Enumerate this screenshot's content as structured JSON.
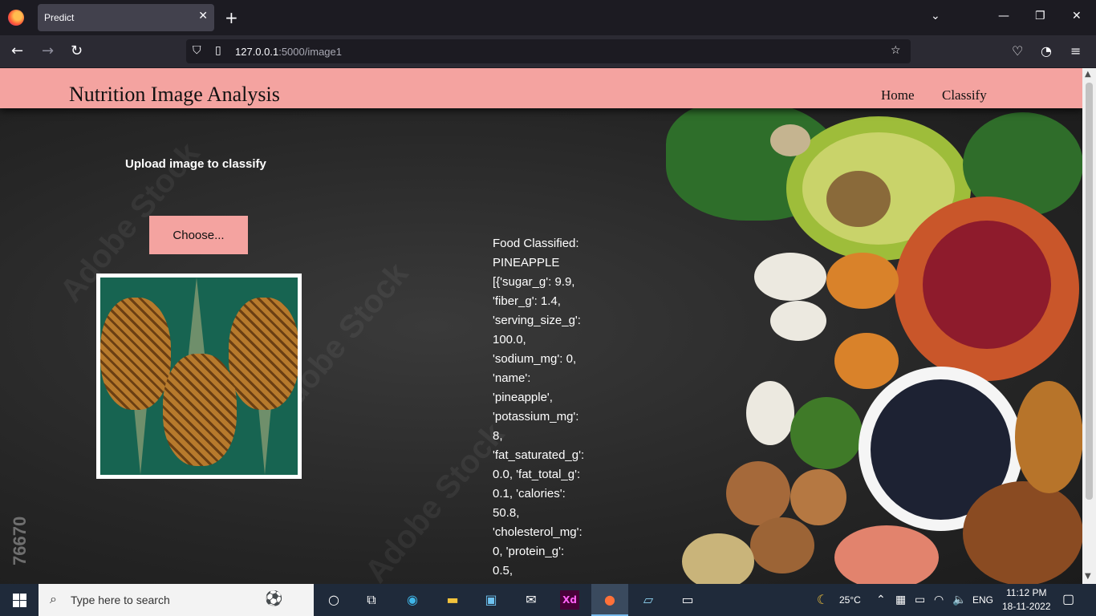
{
  "browser": {
    "tab_title": "Predict",
    "url_host": "127.0.0.1",
    "url_path": ":5000/image1"
  },
  "site": {
    "title": "Nutrition Image Analysis",
    "nav": [
      "Home",
      "Classify"
    ]
  },
  "upload": {
    "label": "Upload image to classify",
    "button": "Choose..."
  },
  "result": {
    "lines": [
      "Food Classified:",
      "PINEAPPLE",
      "[{'sugar_g': 9.9,",
      "'fiber_g': 1.4,",
      "'serving_size_g':",
      "100.0,",
      "'sodium_mg': 0,",
      "'name':",
      "'pineapple',",
      "'potassium_mg':",
      "8,",
      "'fat_saturated_g':",
      "0.0, 'fat_total_g':",
      "0.1, 'calories':",
      "50.8,",
      "'cholesterol_mg':",
      "0, 'protein_g':",
      "0.5,"
    ]
  },
  "watermark": [
    "Adobe Stock",
    "76670"
  ],
  "taskbar": {
    "search_placeholder": "Type here to search",
    "xd_label": "Xd",
    "weather": "25°C",
    "lang": "ENG",
    "time": "11:12 PM",
    "date": "18-11-2022"
  },
  "colors": {
    "header": "#f4a3a0",
    "button": "#f4a3a0"
  }
}
